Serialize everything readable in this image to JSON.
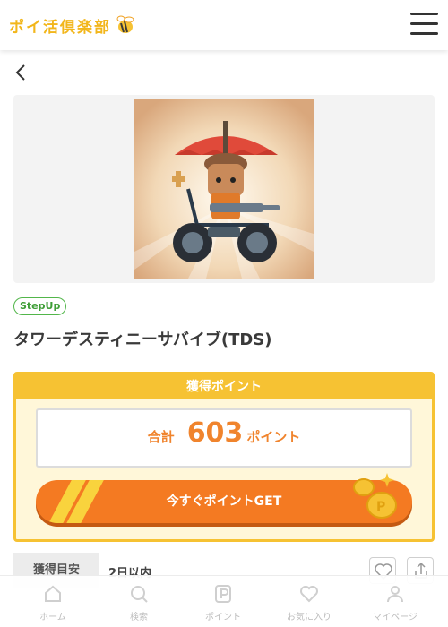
{
  "header": {
    "logo_text": "ポイ活倶楽部",
    "logo_icon": "bee-icon",
    "menu_icon": "hamburger-menu-icon"
  },
  "nav": {
    "back_icon": "chevron-left-icon"
  },
  "offer": {
    "badge": "StepUp",
    "title": "タワーデスティニーサバイブ(TDS)"
  },
  "points": {
    "heading": "獲得ポイント",
    "total_label": "合計",
    "total_value": "603",
    "unit": "ポイント",
    "button_label": "今すぐポイントGET"
  },
  "acquisition": {
    "label": "獲得目安",
    "value": "2日以内"
  },
  "colors": {
    "brand_yellow": "#f6c233",
    "accent_orange": "#f47a22",
    "badge_green": "#52b64a"
  },
  "bottom_nav": {
    "items": [
      {
        "label": "ホーム",
        "icon": "home-icon"
      },
      {
        "label": "検索",
        "icon": "search-icon"
      },
      {
        "label": "ポイント",
        "icon": "point-icon"
      },
      {
        "label": "お気に入り",
        "icon": "heart-icon"
      },
      {
        "label": "マイページ",
        "icon": "user-icon"
      }
    ]
  }
}
